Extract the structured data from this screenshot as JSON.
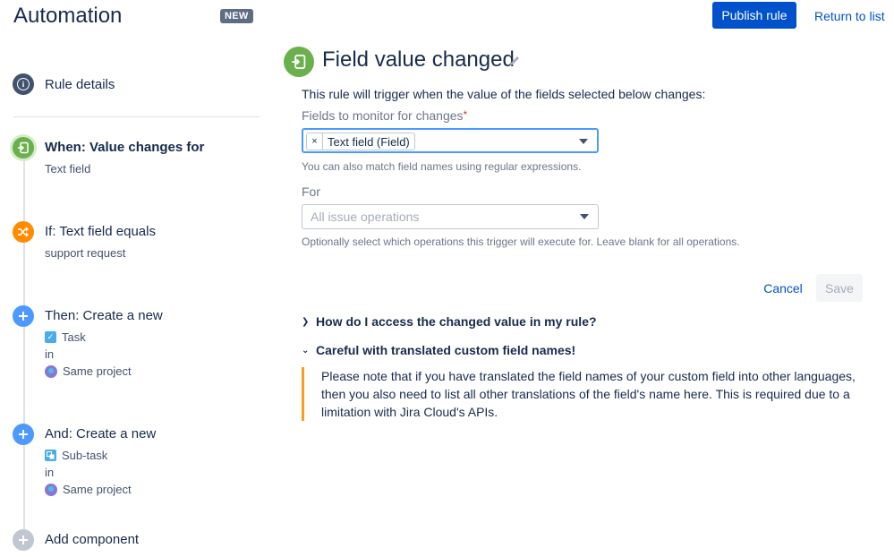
{
  "header": {
    "title": "Automation",
    "badge": "NEW",
    "publish_label": "Publish rule",
    "return_label": "Return to list"
  },
  "sidebar": {
    "rule_details_label": "Rule details",
    "steps": [
      {
        "title": "When: Value changes for",
        "lines": [
          "Text field"
        ],
        "icon": "trigger-icon",
        "color": "#6ab04c"
      },
      {
        "title": "If: Text field equals",
        "lines": [
          "support request"
        ],
        "icon": "shuffle-icon",
        "color": "#ff8b00"
      },
      {
        "title": "Then: Create a new",
        "item": "Task",
        "connector": "in",
        "target": "Same project",
        "icon": "plus-icon",
        "color": "#4c9aff"
      },
      {
        "title": "And: Create a new",
        "item": "Sub-task",
        "connector": "in",
        "target": "Same project",
        "icon": "plus-icon",
        "color": "#4c9aff"
      }
    ],
    "add_component_label": "Add component"
  },
  "main": {
    "title": "Field value changed",
    "description": "This rule will trigger when the value of the fields selected below changes:",
    "fields_label": "Fields to monitor for changes",
    "required_mark": "*",
    "selected_chip": "Text field (Field)",
    "chip_remove": "×",
    "fields_help": "You can also match field names using regular expressions.",
    "for_label": "For",
    "for_placeholder": "All issue operations",
    "for_help": "Optionally select which operations this trigger will execute for. Leave blank for all operations.",
    "cancel_label": "Cancel",
    "save_label": "Save",
    "accordion_1": "How do I access the changed value in my rule?",
    "accordion_2": "Careful with translated custom field names!",
    "note_text": "Please note that if you have translated the field names of your custom field into other languages, then you also need to list all other translations of the field's name here. This is required due to a limitation with Jira Cloud's APIs."
  },
  "colors": {
    "accent": "#0052cc",
    "trigger": "#6ab04c",
    "condition": "#ff8b00",
    "action": "#4c9aff",
    "warning_border": "#ff991f"
  }
}
